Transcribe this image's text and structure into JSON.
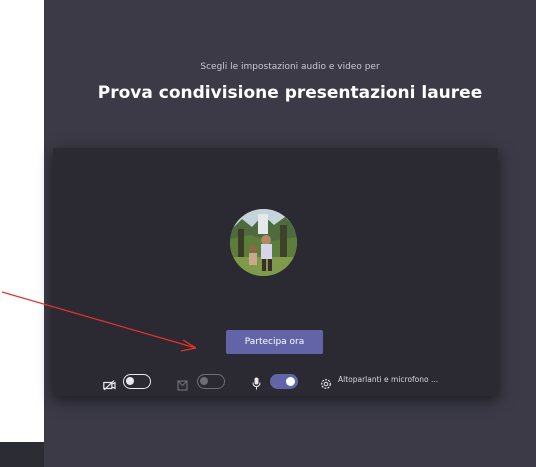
{
  "prejoin": {
    "subtitle": "Scegli le impostazioni audio e video per",
    "title": "Prova condivisione presentazioni lauree",
    "join_button_label": "Partecipa ora"
  },
  "controls": {
    "video": {
      "icon": "camera-off-icon",
      "state": "off"
    },
    "blur": {
      "icon": "background-blur-icon",
      "state": "disabled"
    },
    "mic": {
      "icon": "microphone-icon",
      "state": "on"
    },
    "devices": {
      "icon": "gear-icon",
      "label": "Altoparlanti e microfono ..."
    }
  },
  "colors": {
    "background": "#3b3a46",
    "card": "#2b2a33",
    "accent": "#6264a7",
    "annotation_arrow": "#e8322a"
  }
}
